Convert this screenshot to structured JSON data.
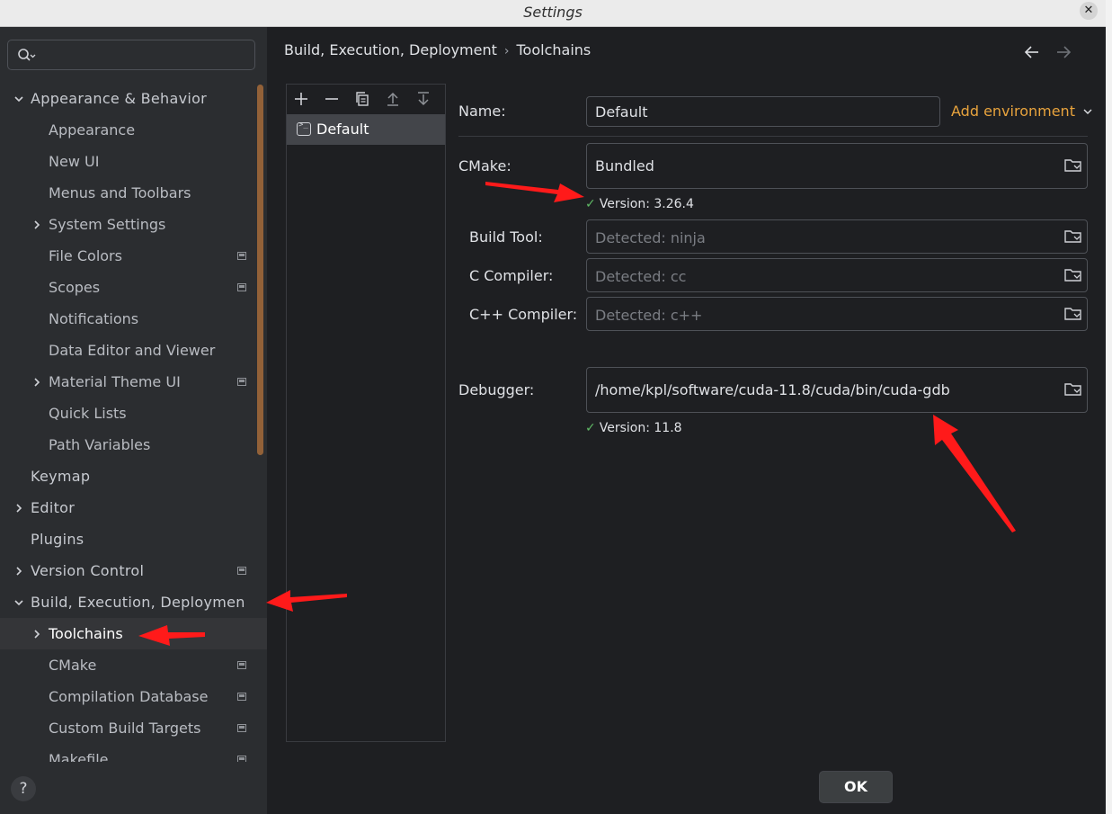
{
  "window": {
    "title": "Settings",
    "close_glyph": "✕"
  },
  "search": {
    "placeholder": ""
  },
  "sidebar": {
    "items": [
      {
        "label": "Appearance & Behavior",
        "level": 0,
        "chevron": "down"
      },
      {
        "label": "Appearance",
        "level": 1
      },
      {
        "label": "New UI",
        "level": 1
      },
      {
        "label": "Menus and Toolbars",
        "level": 1
      },
      {
        "label": "System Settings",
        "level": 1,
        "chevron": "right"
      },
      {
        "label": "File Colors",
        "level": 1,
        "project": true
      },
      {
        "label": "Scopes",
        "level": 1,
        "project": true
      },
      {
        "label": "Notifications",
        "level": 1
      },
      {
        "label": "Data Editor and Viewer",
        "level": 1
      },
      {
        "label": "Material Theme UI",
        "level": 1,
        "chevron": "right",
        "project": true
      },
      {
        "label": "Quick Lists",
        "level": 1
      },
      {
        "label": "Path Variables",
        "level": 1
      },
      {
        "label": "Keymap",
        "level": 0
      },
      {
        "label": "Editor",
        "level": 0,
        "chevron": "right"
      },
      {
        "label": "Plugins",
        "level": 0
      },
      {
        "label": "Version Control",
        "level": 0,
        "chevron": "right",
        "project": true
      },
      {
        "label": "Build, Execution, Deploymen",
        "level": 0,
        "chevron": "down"
      },
      {
        "label": "Toolchains",
        "level": 1,
        "chevron": "right",
        "selected": true
      },
      {
        "label": "CMake",
        "level": 1,
        "project": true
      },
      {
        "label": "Compilation Database",
        "level": 1,
        "project": true
      },
      {
        "label": "Custom Build Targets",
        "level": 1,
        "project": true
      },
      {
        "label": "Makefile",
        "level": 1,
        "project": true
      }
    ]
  },
  "breadcrumb": {
    "parent": "Build, Execution, Deployment",
    "separator": "›",
    "current": "Toolchains"
  },
  "toolchains": {
    "toolbar": [
      "add-icon",
      "remove-icon",
      "copy-icon",
      "move-up-icon",
      "move-down-icon"
    ],
    "items": [
      {
        "label": "Default"
      }
    ]
  },
  "form": {
    "name_label": "Name:",
    "name_value": "Default",
    "add_environment": "Add environment",
    "cmake_label": "CMake:",
    "cmake_value": "Bundled",
    "cmake_version": "Version: 3.26.4",
    "build_tool_label": "Build Tool:",
    "build_tool_placeholder": "Detected: ninja",
    "c_compiler_label": "C Compiler:",
    "c_compiler_placeholder": "Detected: cc",
    "cpp_compiler_label": "C++ Compiler:",
    "cpp_compiler_placeholder": "Detected: c++",
    "debugger_label": "Debugger:",
    "debugger_value": "/home/kpl/software/cuda-11.8/cuda/bin/cuda-gdb",
    "debugger_version": "Version: 11.8",
    "check_glyph": "✓"
  },
  "footer": {
    "help": "?",
    "ok": "OK"
  },
  "colors": {
    "accent_orange": "#e8a33d",
    "check_green": "#5fb865",
    "annotation_red": "#ff1a1a"
  }
}
